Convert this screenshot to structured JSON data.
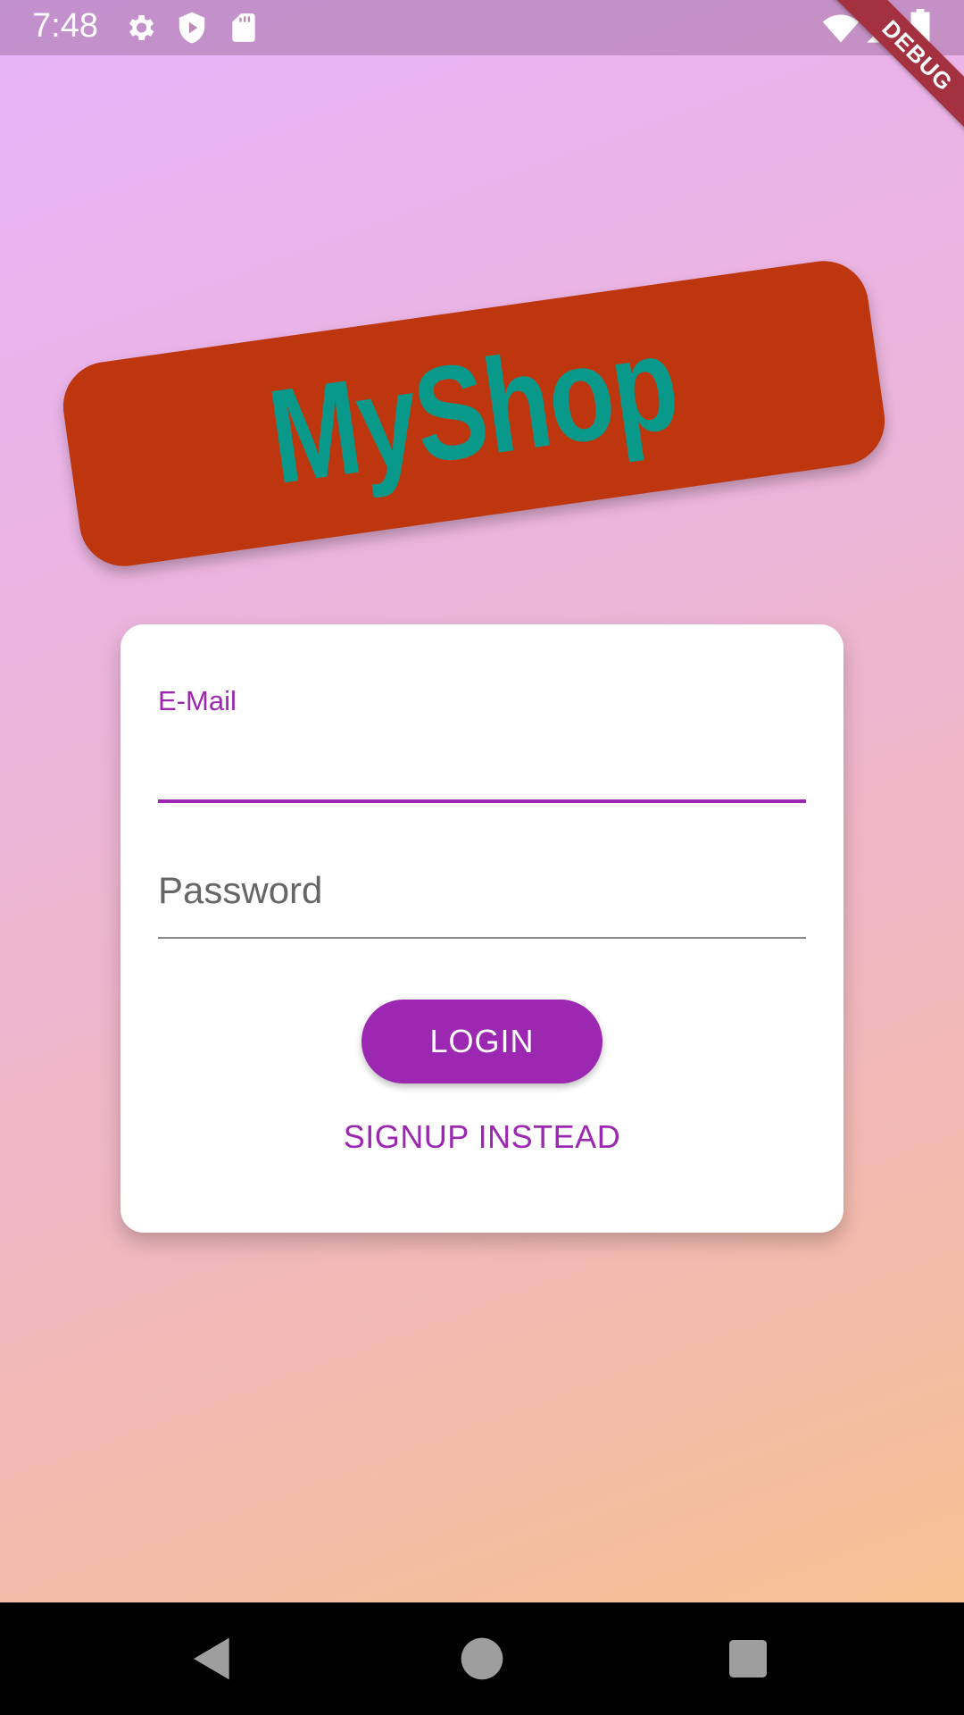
{
  "status_bar": {
    "time": "7:48",
    "icons": [
      "settings-icon",
      "shield-play-icon",
      "sd-card-icon",
      "wifi-icon",
      "signal-icon",
      "battery-icon"
    ]
  },
  "debug_banner": {
    "label": "DEBUG"
  },
  "logo": {
    "text": "MyShop"
  },
  "form": {
    "email": {
      "label": "E-Mail",
      "value": ""
    },
    "password": {
      "label": "Password",
      "value": ""
    },
    "login_label": "LOGIN",
    "signup_label": "SIGNUP INSTEAD"
  },
  "nav": {
    "icons": [
      "back-icon",
      "home-icon",
      "recents-icon"
    ]
  },
  "colors": {
    "accent": "#9c27b0",
    "logo_badge": "#bd360e",
    "logo_text": "#08998a",
    "debug_banner": "#a3313f"
  }
}
